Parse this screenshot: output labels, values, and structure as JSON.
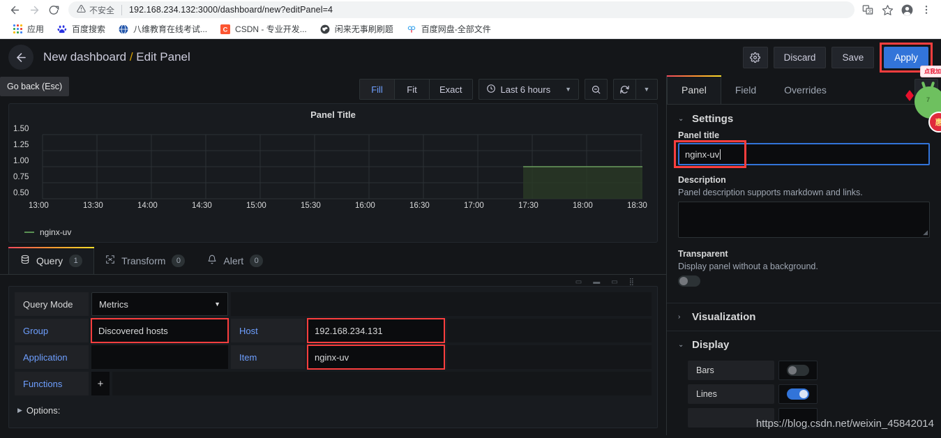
{
  "browser": {
    "back_icon": "back-arrow-icon",
    "forward_icon": "forward-arrow-icon",
    "reload_icon": "reload-icon",
    "security_label": "不安全",
    "url": "192.168.234.132:3000/dashboard/new?editPanel=4",
    "translate_icon": "translate-icon",
    "bookmark_star_icon": "star-icon",
    "profile_icon": "profile-icon",
    "menu_icon": "kebab-menu-icon",
    "bookmarks": [
      {
        "label": "应用",
        "icon": "apps-grid-icon"
      },
      {
        "label": "百度搜索",
        "icon": "baidu-icon"
      },
      {
        "label": "八维教育在线考试...",
        "icon": "globe-icon"
      },
      {
        "label": "CSDN - 专业开发...",
        "icon": "csdn-icon"
      },
      {
        "label": "闲来无事刷刷题",
        "icon": "dark-globe-icon"
      },
      {
        "label": "百度网盘-全部文件",
        "icon": "baidu-pan-icon"
      }
    ]
  },
  "app_header": {
    "back_icon": "arrow-left-icon",
    "breadcrumb_dashboard": "New dashboard",
    "breadcrumb_sep": "/",
    "breadcrumb_page": "Edit Panel",
    "settings_icon": "gear-icon",
    "discard_label": "Discard",
    "save_label": "Save",
    "apply_label": "Apply",
    "accent_blue": "#3274d9",
    "highlight_red": "#fa3e3e"
  },
  "tooltip": {
    "go_back": "Go back (Esc)"
  },
  "viz_toolbar": {
    "size_modes": [
      "Fill",
      "Fit",
      "Exact"
    ],
    "active_mode": "Fill",
    "clock_icon": "clock-icon",
    "time_range": "Last 6 hours",
    "time_caret": "chevron-down-icon",
    "zoom_out_icon": "zoom-out-icon",
    "refresh_icon": "refresh-icon",
    "refresh_caret": "chevron-down-icon"
  },
  "chart_data": {
    "type": "line",
    "title": "Panel Title",
    "xlabel": "",
    "ylabel": "",
    "x_ticks": [
      "13:00",
      "13:30",
      "14:00",
      "14:30",
      "15:00",
      "15:30",
      "16:00",
      "16:30",
      "17:00",
      "17:30",
      "18:00",
      "18:30"
    ],
    "y_ticks": [
      "1.50",
      "1.25",
      "1.00",
      "0.75",
      "0.50"
    ],
    "ylim": [
      0.5,
      1.5
    ],
    "grid": true,
    "legend_position": "bottom-left",
    "series": [
      {
        "name": "nginx-uv",
        "color": "#5a9153",
        "fill": true,
        "x": [
          "17:25",
          "17:30",
          "18:00",
          "18:30",
          "18:55"
        ],
        "values": [
          1.0,
          1.0,
          1.0,
          1.0,
          1.0
        ]
      }
    ]
  },
  "query_tabs": [
    {
      "label": "Query",
      "count": "1",
      "icon": "database-icon",
      "active": true
    },
    {
      "label": "Transform",
      "count": "0",
      "icon": "transform-icon",
      "active": false
    },
    {
      "label": "Alert",
      "count": "0",
      "icon": "bell-icon",
      "active": false
    }
  ],
  "query_editor": {
    "query_mode_label": "Query Mode",
    "query_mode_value": "Metrics",
    "query_mode_caret": "caret-down-icon",
    "group_label": "Group",
    "group_value": "Discovered hosts",
    "host_label": "Host",
    "host_value": "192.168.234.131",
    "application_label": "Application",
    "application_value": "",
    "item_label": "Item",
    "item_value": "nginx-uv",
    "functions_label": "Functions",
    "functions_add": "+",
    "options_label": "Options:",
    "options_caret": "caret-right-icon"
  },
  "options_pane": {
    "tabs": [
      {
        "label": "Panel",
        "active": true
      },
      {
        "label": "Field",
        "active": false
      },
      {
        "label": "Overrides",
        "active": false
      }
    ],
    "expand_icon": "chevron-right-icon",
    "settings": {
      "chevron": "chevron-down-icon",
      "title": "Settings",
      "panel_title_label": "Panel title",
      "panel_title_value": "nginx-uv",
      "description_label": "Description",
      "description_help": "Panel description supports markdown and links.",
      "description_value": "",
      "transparent_label": "Transparent",
      "transparent_help": "Display panel without a background.",
      "transparent_on": false
    },
    "visualization": {
      "chevron": "chevron-right-icon",
      "title": "Visualization"
    },
    "display": {
      "chevron": "chevron-down-icon",
      "title": "Display",
      "rows": [
        {
          "label": "Bars",
          "on": false
        },
        {
          "label": "Lines",
          "on": true
        }
      ]
    }
  },
  "overlays": {
    "watermark": "https://blog.csdn.net/weixin_45842014",
    "promo_text": "点我加速",
    "promo_number": "7",
    "promo_coin": "惠"
  }
}
